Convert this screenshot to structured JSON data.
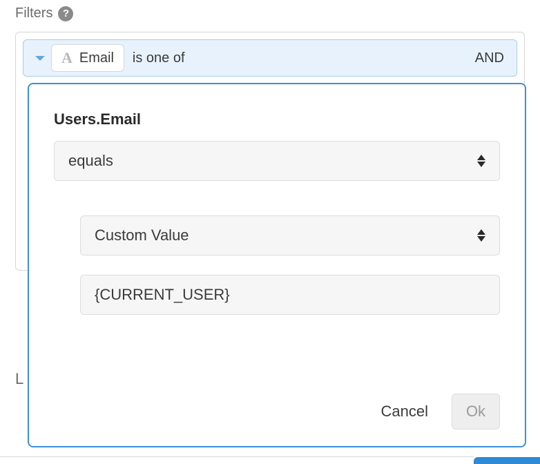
{
  "filters": {
    "label": "Filters",
    "row": {
      "field": "Email",
      "condition": "is one of",
      "joiner": "AND"
    }
  },
  "popup": {
    "title": "Users.Email",
    "operator": "equals",
    "value_type": "Custom Value",
    "value": "{CURRENT_USER}",
    "cancel": "Cancel",
    "ok": "Ok"
  },
  "stray": {
    "l": "L"
  }
}
